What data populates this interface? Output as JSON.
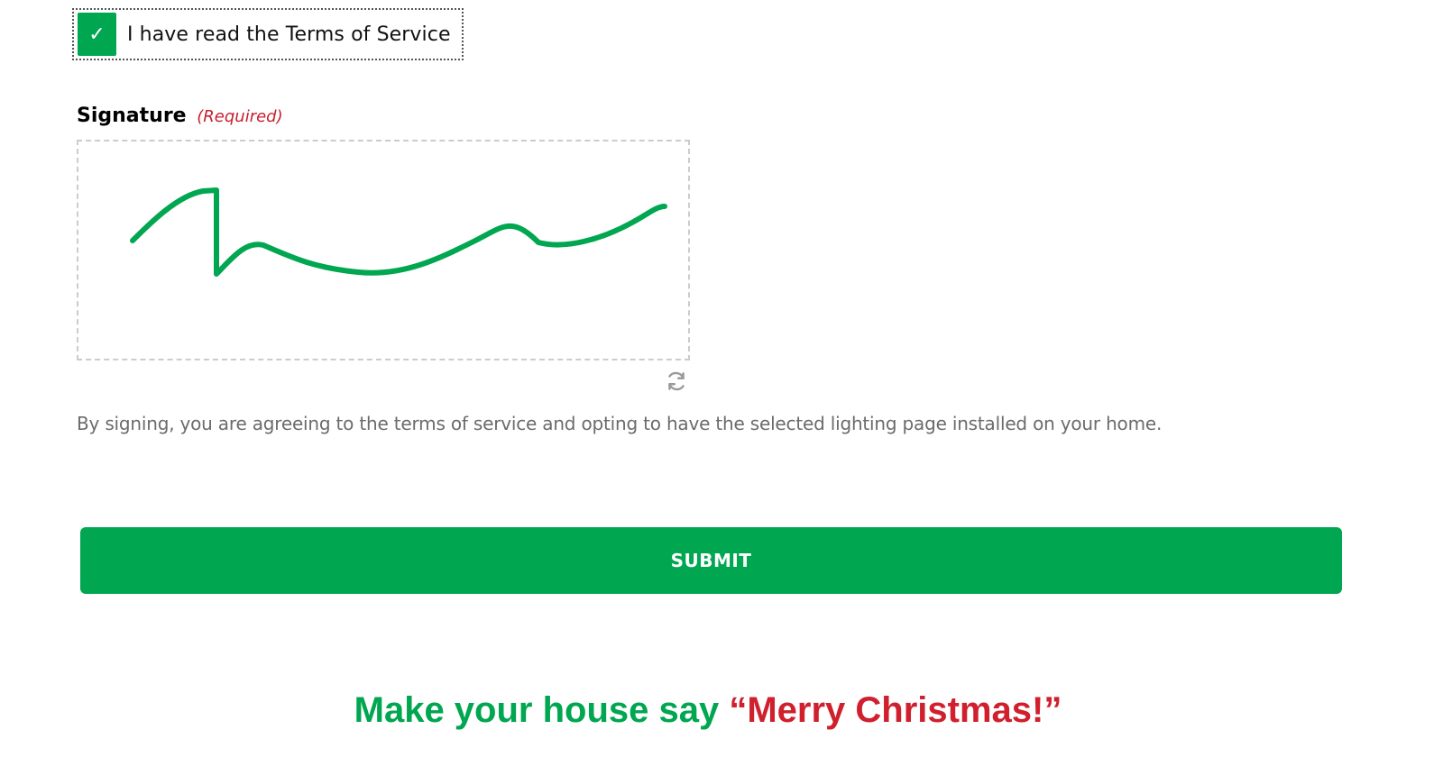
{
  "terms": {
    "checked": true,
    "check_glyph": "✓",
    "label": "I have read the Terms of Service"
  },
  "signature": {
    "label": "Signature",
    "required": "(Required)",
    "stroke_color": "#00a650",
    "reset_icon": "refresh-icon",
    "description": "By signing, you are agreeing to the terms of service and opting to have the selected lighting page installed on your home."
  },
  "submit": {
    "label": "SUBMIT"
  },
  "tagline": {
    "part1": "Make your house say ",
    "part2": "“Merry Christmas!”"
  },
  "colors": {
    "brand_green": "#00a650",
    "required_red": "#c8202e",
    "tagline_red": "#d0202e"
  }
}
